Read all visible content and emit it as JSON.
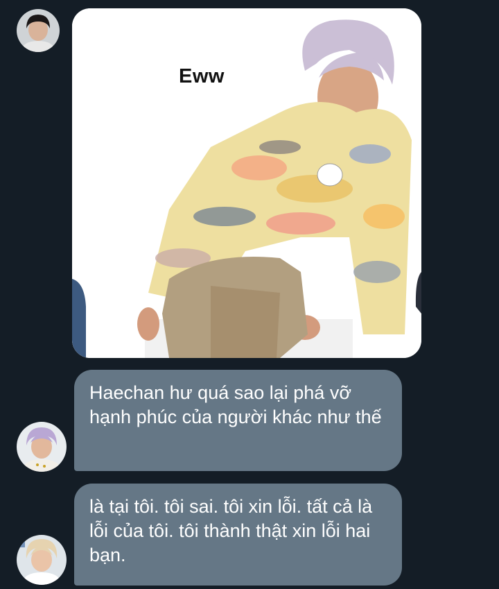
{
  "conversation": {
    "image_message": {
      "meme_caption": "Eww",
      "sender_avatar": "avatar-dark-hair-person"
    },
    "messages": [
      {
        "text": "Haechan hư quá sao lại phá vỡ hạnh phúc của người khác như thế",
        "sender_avatar": "avatar-lavender-hair-person"
      },
      {
        "text": "là tại tôi. tôi sai. tôi xin lỗi. tất cả là lỗi của tôi. tôi thành thật xin lỗi hai bạn.",
        "sender_avatar": "avatar-blonde-hair-person"
      }
    ]
  },
  "colors": {
    "background": "#141d26",
    "bubble": "#657786",
    "bubble_text": "#ffffff"
  }
}
